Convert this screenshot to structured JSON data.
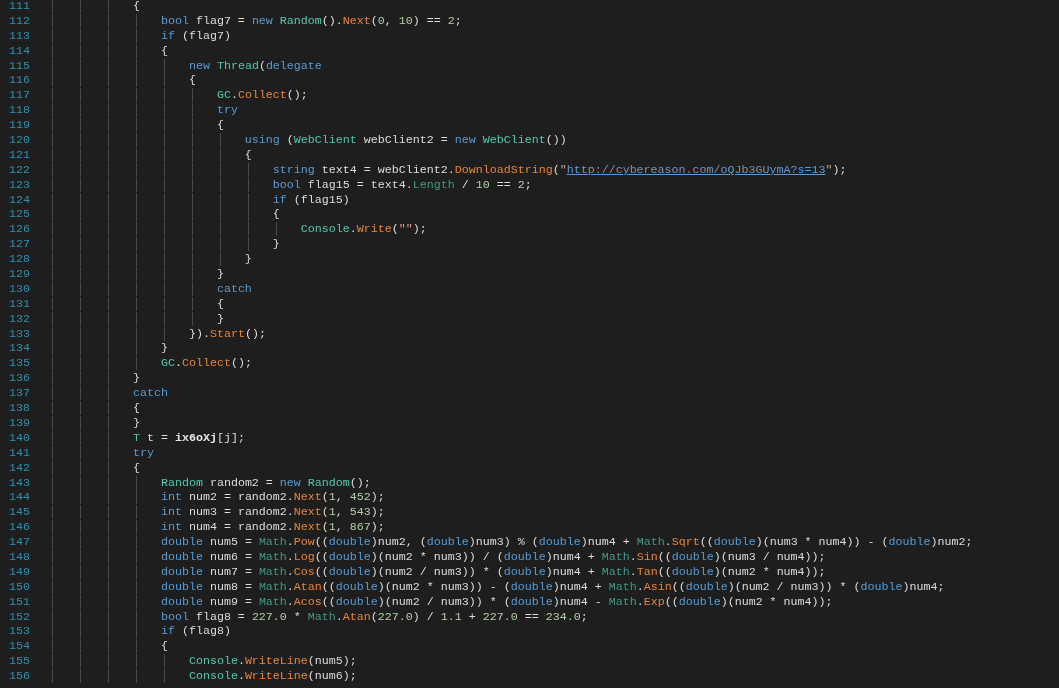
{
  "editor": {
    "lines": [
      {
        "number": "111",
        "tokens": [
          {
            "kind": "plain",
            "text": "            {"
          }
        ]
      },
      {
        "number": "112",
        "tokens": [
          {
            "kind": "keyword",
            "text": "                bool"
          },
          {
            "kind": "plain",
            "text": " flag7 = "
          },
          {
            "kind": "keyword",
            "text": "new"
          },
          {
            "kind": "type",
            "text": " Random"
          },
          {
            "kind": "plain",
            "text": "()."
          },
          {
            "kind": "method",
            "text": "Next"
          },
          {
            "kind": "plain",
            "text": "("
          },
          {
            "kind": "number",
            "text": "0"
          },
          {
            "kind": "plain",
            "text": ", "
          },
          {
            "kind": "number",
            "text": "10"
          },
          {
            "kind": "plain",
            "text": ") == "
          },
          {
            "kind": "number",
            "text": "2"
          },
          {
            "kind": "plain",
            "text": ";"
          }
        ]
      },
      {
        "number": "113",
        "tokens": [
          {
            "kind": "keyword",
            "text": "                if"
          },
          {
            "kind": "plain",
            "text": " (flag7)"
          }
        ]
      },
      {
        "number": "114",
        "tokens": [
          {
            "kind": "plain",
            "text": "                {"
          }
        ]
      },
      {
        "number": "115",
        "tokens": [
          {
            "kind": "keyword",
            "text": "                    new"
          },
          {
            "kind": "type",
            "text": " Thread"
          },
          {
            "kind": "plain",
            "text": "("
          },
          {
            "kind": "keyword",
            "text": "delegate"
          }
        ]
      },
      {
        "number": "116",
        "tokens": [
          {
            "kind": "plain",
            "text": "                    {"
          }
        ]
      },
      {
        "number": "117",
        "tokens": [
          {
            "kind": "type",
            "text": "                        GC"
          },
          {
            "kind": "plain",
            "text": "."
          },
          {
            "kind": "method",
            "text": "Collect"
          },
          {
            "kind": "plain",
            "text": "();"
          }
        ]
      },
      {
        "number": "118",
        "tokens": [
          {
            "kind": "keyword",
            "text": "                        try"
          }
        ]
      },
      {
        "number": "119",
        "tokens": [
          {
            "kind": "plain",
            "text": "                        {"
          }
        ]
      },
      {
        "number": "120",
        "tokens": [
          {
            "kind": "keyword",
            "text": "                            using"
          },
          {
            "kind": "plain",
            "text": " ("
          },
          {
            "kind": "type",
            "text": "WebClient"
          },
          {
            "kind": "plain",
            "text": " webClient2 = "
          },
          {
            "kind": "keyword",
            "text": "new"
          },
          {
            "kind": "type",
            "text": " WebClient"
          },
          {
            "kind": "plain",
            "text": "())"
          }
        ]
      },
      {
        "number": "121",
        "tokens": [
          {
            "kind": "plain",
            "text": "                            {"
          }
        ]
      },
      {
        "number": "122",
        "tokens": [
          {
            "kind": "keyword",
            "text": "                                string"
          },
          {
            "kind": "plain",
            "text": " text4 = webClient2."
          },
          {
            "kind": "method",
            "text": "DownloadString"
          },
          {
            "kind": "plain",
            "text": "("
          },
          {
            "kind": "string",
            "text": "\""
          },
          {
            "kind": "url",
            "text": "http://cybereason.com/oQJb3GUymA?s=13"
          },
          {
            "kind": "string",
            "text": "\""
          },
          {
            "kind": "plain",
            "text": ");"
          }
        ]
      },
      {
        "number": "123",
        "tokens": [
          {
            "kind": "keyword",
            "text": "                                bool"
          },
          {
            "kind": "plain",
            "text": " flag15 = text4."
          },
          {
            "kind": "member",
            "text": "Length"
          },
          {
            "kind": "plain",
            "text": " / "
          },
          {
            "kind": "number",
            "text": "10"
          },
          {
            "kind": "plain",
            "text": " == "
          },
          {
            "kind": "number",
            "text": "2"
          },
          {
            "kind": "plain",
            "text": ";"
          }
        ]
      },
      {
        "number": "124",
        "tokens": [
          {
            "kind": "keyword",
            "text": "                                if"
          },
          {
            "kind": "plain",
            "text": " (flag15)"
          }
        ]
      },
      {
        "number": "125",
        "tokens": [
          {
            "kind": "plain",
            "text": "                                {"
          }
        ]
      },
      {
        "number": "126",
        "tokens": [
          {
            "kind": "type",
            "text": "                                    Console"
          },
          {
            "kind": "plain",
            "text": "."
          },
          {
            "kind": "method",
            "text": "Write"
          },
          {
            "kind": "plain",
            "text": "("
          },
          {
            "kind": "string",
            "text": "\"\""
          },
          {
            "kind": "plain",
            "text": ");"
          }
        ]
      },
      {
        "number": "127",
        "tokens": [
          {
            "kind": "plain",
            "text": "                                }"
          }
        ]
      },
      {
        "number": "128",
        "tokens": [
          {
            "kind": "plain",
            "text": "                            }"
          }
        ]
      },
      {
        "number": "129",
        "tokens": [
          {
            "kind": "plain",
            "text": "                        }"
          }
        ]
      },
      {
        "number": "130",
        "tokens": [
          {
            "kind": "keyword",
            "text": "                        catch"
          }
        ]
      },
      {
        "number": "131",
        "tokens": [
          {
            "kind": "plain",
            "text": "                        {"
          }
        ]
      },
      {
        "number": "132",
        "tokens": [
          {
            "kind": "plain",
            "text": "                        }"
          }
        ]
      },
      {
        "number": "133",
        "tokens": [
          {
            "kind": "plain",
            "text": "                    })."
          },
          {
            "kind": "method",
            "text": "Start"
          },
          {
            "kind": "plain",
            "text": "();"
          }
        ]
      },
      {
        "number": "134",
        "tokens": [
          {
            "kind": "plain",
            "text": "                }"
          }
        ]
      },
      {
        "number": "135",
        "tokens": [
          {
            "kind": "type",
            "text": "                GC"
          },
          {
            "kind": "plain",
            "text": "."
          },
          {
            "kind": "method",
            "text": "Collect"
          },
          {
            "kind": "plain",
            "text": "();"
          }
        ]
      },
      {
        "number": "136",
        "tokens": [
          {
            "kind": "plain",
            "text": "            }"
          }
        ]
      },
      {
        "number": "137",
        "tokens": [
          {
            "kind": "keyword",
            "text": "            catch"
          }
        ]
      },
      {
        "number": "138",
        "tokens": [
          {
            "kind": "plain",
            "text": "            {"
          }
        ]
      },
      {
        "number": "139",
        "tokens": [
          {
            "kind": "plain",
            "text": "            }"
          }
        ]
      },
      {
        "number": "140",
        "tokens": [
          {
            "kind": "type",
            "text": "            T"
          },
          {
            "kind": "plain",
            "text": " t = "
          },
          {
            "kind": "bold",
            "text": "ix6oXj"
          },
          {
            "kind": "plain",
            "text": "[j];"
          }
        ]
      },
      {
        "number": "141",
        "tokens": [
          {
            "kind": "keyword",
            "text": "            try"
          }
        ]
      },
      {
        "number": "142",
        "tokens": [
          {
            "kind": "plain",
            "text": "            {"
          }
        ]
      },
      {
        "number": "143",
        "tokens": [
          {
            "kind": "type",
            "text": "                Random"
          },
          {
            "kind": "plain",
            "text": " random2 = "
          },
          {
            "kind": "keyword",
            "text": "new"
          },
          {
            "kind": "type",
            "text": " Random"
          },
          {
            "kind": "plain",
            "text": "();"
          }
        ]
      },
      {
        "number": "144",
        "tokens": [
          {
            "kind": "keyword",
            "text": "                int"
          },
          {
            "kind": "plain",
            "text": " num2 = random2."
          },
          {
            "kind": "method",
            "text": "Next"
          },
          {
            "kind": "plain",
            "text": "("
          },
          {
            "kind": "number",
            "text": "1"
          },
          {
            "kind": "plain",
            "text": ", "
          },
          {
            "kind": "number",
            "text": "452"
          },
          {
            "kind": "plain",
            "text": ");"
          }
        ]
      },
      {
        "number": "145",
        "tokens": [
          {
            "kind": "keyword",
            "text": "                int"
          },
          {
            "kind": "plain",
            "text": " num3 = random2."
          },
          {
            "kind": "method",
            "text": "Next"
          },
          {
            "kind": "plain",
            "text": "("
          },
          {
            "kind": "number",
            "text": "1"
          },
          {
            "kind": "plain",
            "text": ", "
          },
          {
            "kind": "number",
            "text": "543"
          },
          {
            "kind": "plain",
            "text": ");"
          }
        ]
      },
      {
        "number": "146",
        "tokens": [
          {
            "kind": "keyword",
            "text": "                int"
          },
          {
            "kind": "plain",
            "text": " num4 = random2."
          },
          {
            "kind": "method",
            "text": "Next"
          },
          {
            "kind": "plain",
            "text": "("
          },
          {
            "kind": "number",
            "text": "1"
          },
          {
            "kind": "plain",
            "text": ", "
          },
          {
            "kind": "number",
            "text": "867"
          },
          {
            "kind": "plain",
            "text": ");"
          }
        ]
      },
      {
        "number": "147",
        "tokens": [
          {
            "kind": "keyword",
            "text": "                double"
          },
          {
            "kind": "plain",
            "text": " num5 = "
          },
          {
            "kind": "member",
            "text": "Math"
          },
          {
            "kind": "plain",
            "text": "."
          },
          {
            "kind": "method",
            "text": "Pow"
          },
          {
            "kind": "plain",
            "text": "(("
          },
          {
            "kind": "keyword",
            "text": "double"
          },
          {
            "kind": "plain",
            "text": ")num2, ("
          },
          {
            "kind": "keyword",
            "text": "double"
          },
          {
            "kind": "plain",
            "text": ")num3) % ("
          },
          {
            "kind": "keyword",
            "text": "double"
          },
          {
            "kind": "plain",
            "text": ")num4 + "
          },
          {
            "kind": "member",
            "text": "Math"
          },
          {
            "kind": "plain",
            "text": "."
          },
          {
            "kind": "method",
            "text": "Sqrt"
          },
          {
            "kind": "plain",
            "text": "(("
          },
          {
            "kind": "keyword",
            "text": "double"
          },
          {
            "kind": "plain",
            "text": ")(num3 * num4)) - ("
          },
          {
            "kind": "keyword",
            "text": "double"
          },
          {
            "kind": "plain",
            "text": ")num2;"
          }
        ]
      },
      {
        "number": "148",
        "tokens": [
          {
            "kind": "keyword",
            "text": "                double"
          },
          {
            "kind": "plain",
            "text": " num6 = "
          },
          {
            "kind": "member",
            "text": "Math"
          },
          {
            "kind": "plain",
            "text": "."
          },
          {
            "kind": "method",
            "text": "Log"
          },
          {
            "kind": "plain",
            "text": "(("
          },
          {
            "kind": "keyword",
            "text": "double"
          },
          {
            "kind": "plain",
            "text": ")(num2 * num3)) / ("
          },
          {
            "kind": "keyword",
            "text": "double"
          },
          {
            "kind": "plain",
            "text": ")num4 + "
          },
          {
            "kind": "member",
            "text": "Math"
          },
          {
            "kind": "plain",
            "text": "."
          },
          {
            "kind": "method",
            "text": "Sin"
          },
          {
            "kind": "plain",
            "text": "(("
          },
          {
            "kind": "keyword",
            "text": "double"
          },
          {
            "kind": "plain",
            "text": ")(num3 / num4));"
          }
        ]
      },
      {
        "number": "149",
        "tokens": [
          {
            "kind": "keyword",
            "text": "                double"
          },
          {
            "kind": "plain",
            "text": " num7 = "
          },
          {
            "kind": "member",
            "text": "Math"
          },
          {
            "kind": "plain",
            "text": "."
          },
          {
            "kind": "method",
            "text": "Cos"
          },
          {
            "kind": "plain",
            "text": "(("
          },
          {
            "kind": "keyword",
            "text": "double"
          },
          {
            "kind": "plain",
            "text": ")(num2 / num3)) * ("
          },
          {
            "kind": "keyword",
            "text": "double"
          },
          {
            "kind": "plain",
            "text": ")num4 + "
          },
          {
            "kind": "member",
            "text": "Math"
          },
          {
            "kind": "plain",
            "text": "."
          },
          {
            "kind": "method",
            "text": "Tan"
          },
          {
            "kind": "plain",
            "text": "(("
          },
          {
            "kind": "keyword",
            "text": "double"
          },
          {
            "kind": "plain",
            "text": ")(num2 * num4));"
          }
        ]
      },
      {
        "number": "150",
        "tokens": [
          {
            "kind": "keyword",
            "text": "                double"
          },
          {
            "kind": "plain",
            "text": " num8 = "
          },
          {
            "kind": "member",
            "text": "Math"
          },
          {
            "kind": "plain",
            "text": "."
          },
          {
            "kind": "method",
            "text": "Atan"
          },
          {
            "kind": "plain",
            "text": "(("
          },
          {
            "kind": "keyword",
            "text": "double"
          },
          {
            "kind": "plain",
            "text": ")(num2 * num3)) - ("
          },
          {
            "kind": "keyword",
            "text": "double"
          },
          {
            "kind": "plain",
            "text": ")num4 + "
          },
          {
            "kind": "member",
            "text": "Math"
          },
          {
            "kind": "plain",
            "text": "."
          },
          {
            "kind": "method",
            "text": "Asin"
          },
          {
            "kind": "plain",
            "text": "(("
          },
          {
            "kind": "keyword",
            "text": "double"
          },
          {
            "kind": "plain",
            "text": ")(num2 / num3)) * ("
          },
          {
            "kind": "keyword",
            "text": "double"
          },
          {
            "kind": "plain",
            "text": ")num4;"
          }
        ]
      },
      {
        "number": "151",
        "tokens": [
          {
            "kind": "keyword",
            "text": "                double"
          },
          {
            "kind": "plain",
            "text": " num9 = "
          },
          {
            "kind": "member",
            "text": "Math"
          },
          {
            "kind": "plain",
            "text": "."
          },
          {
            "kind": "method",
            "text": "Acos"
          },
          {
            "kind": "plain",
            "text": "(("
          },
          {
            "kind": "keyword",
            "text": "double"
          },
          {
            "kind": "plain",
            "text": ")(num2 / num3)) * ("
          },
          {
            "kind": "keyword",
            "text": "double"
          },
          {
            "kind": "plain",
            "text": ")num4 - "
          },
          {
            "kind": "member",
            "text": "Math"
          },
          {
            "kind": "plain",
            "text": "."
          },
          {
            "kind": "method",
            "text": "Exp"
          },
          {
            "kind": "plain",
            "text": "(("
          },
          {
            "kind": "keyword",
            "text": "double"
          },
          {
            "kind": "plain",
            "text": ")(num2 * num4));"
          }
        ]
      },
      {
        "number": "152",
        "tokens": [
          {
            "kind": "keyword",
            "text": "                bool"
          },
          {
            "kind": "plain",
            "text": " flag8 = "
          },
          {
            "kind": "number",
            "text": "227.0"
          },
          {
            "kind": "plain",
            "text": " * "
          },
          {
            "kind": "member",
            "text": "Math"
          },
          {
            "kind": "plain",
            "text": "."
          },
          {
            "kind": "method",
            "text": "Atan"
          },
          {
            "kind": "plain",
            "text": "("
          },
          {
            "kind": "number",
            "text": "227.0"
          },
          {
            "kind": "plain",
            "text": ") / "
          },
          {
            "kind": "number",
            "text": "1.1"
          },
          {
            "kind": "plain",
            "text": " + "
          },
          {
            "kind": "number",
            "text": "227.0"
          },
          {
            "kind": "plain",
            "text": " == "
          },
          {
            "kind": "number",
            "text": "234.0"
          },
          {
            "kind": "plain",
            "text": ";"
          }
        ]
      },
      {
        "number": "153",
        "tokens": [
          {
            "kind": "keyword",
            "text": "                if"
          },
          {
            "kind": "plain",
            "text": " (flag8)"
          }
        ]
      },
      {
        "number": "154",
        "tokens": [
          {
            "kind": "plain",
            "text": "                {"
          }
        ]
      },
      {
        "number": "155",
        "tokens": [
          {
            "kind": "type",
            "text": "                    Console"
          },
          {
            "kind": "plain",
            "text": "."
          },
          {
            "kind": "method",
            "text": "WriteLine"
          },
          {
            "kind": "plain",
            "text": "(num5);"
          }
        ]
      },
      {
        "number": "156",
        "tokens": [
          {
            "kind": "type",
            "text": "                    Console"
          },
          {
            "kind": "plain",
            "text": "."
          },
          {
            "kind": "method",
            "text": "WriteLine"
          },
          {
            "kind": "plain",
            "text": "(num6);"
          }
        ]
      }
    ]
  }
}
